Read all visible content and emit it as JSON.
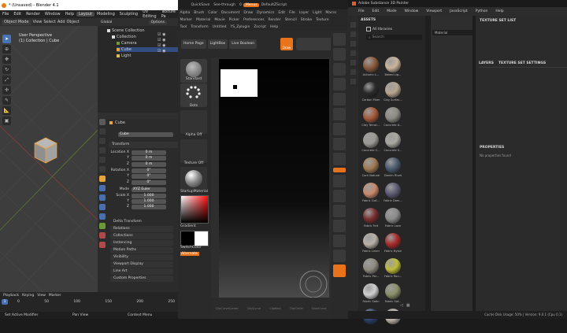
{
  "blender": {
    "title": "* (Unsaved) - Blender 4.1",
    "workspaces": [
      "File",
      "Edit",
      "Render",
      "Window",
      "Help",
      "Layout",
      "Modeling",
      "Sculpting",
      "UV Editing",
      "Texture Pa"
    ],
    "mode": "Object Mode",
    "view_menu": [
      "View",
      "Select",
      "Add",
      "Object"
    ],
    "global": "Global",
    "options": "Options",
    "viewport_title": "User Perspective",
    "viewport_subtitle": "(1) Collection | Cube",
    "outliner": {
      "root": "Scene Collection",
      "items": [
        "Collection",
        "Camera",
        "Cube",
        "Light"
      ]
    },
    "properties": {
      "object_name": "Cube",
      "name_field": "Cube",
      "transform": "Transform",
      "location_label": "Location X",
      "location": [
        "0 m",
        "0 m",
        "0 m"
      ],
      "axes": [
        "Y",
        "Z"
      ],
      "rotation_label": "Rotation X",
      "rotation": [
        "0°",
        "0°",
        "0°"
      ],
      "mode_label": "Mode",
      "mode_value": "XYZ Euler",
      "scale_label": "Scale X",
      "scale": [
        "1.000",
        "1.000",
        "1.000"
      ],
      "sections": [
        "Delta Transform",
        "Relations",
        "Collections",
        "Instancing",
        "Motion Paths",
        "Visibility",
        "Viewport Display",
        "Line Art",
        "Custom Properties"
      ]
    },
    "timeline": {
      "menu": [
        "Playback",
        "Keying",
        "View",
        "Marker"
      ],
      "frame": "1",
      "ticks": [
        "0",
        "50",
        "100",
        "150",
        "200",
        "250"
      ],
      "status": [
        "Set Active Modifier",
        "Pan View",
        "Context Menu"
      ]
    }
  },
  "zbrush": {
    "top_menu": [
      "QuickSave",
      "See-through",
      "0",
      "Menus",
      "DefaultZScript"
    ],
    "menu_row1": [
      "Alpha",
      "Brush",
      "Color",
      "Document",
      "Draw",
      "Dynamics",
      "Edit",
      "File",
      "Layer",
      "Light",
      "Macro"
    ],
    "menu_row2": [
      "Marker",
      "Material",
      "Movie",
      "Picker",
      "Preferences",
      "Render",
      "Stencil",
      "Stroke",
      "Texture"
    ],
    "menu_row3": [
      "Tool",
      "Transform",
      "Untitled",
      "YS_Zplugin",
      "Zscript",
      "Help"
    ],
    "shelf": [
      "Home Page",
      "LightBox",
      "Live Boolean"
    ],
    "draw_btn": "Draw",
    "left_labels": [
      "Standard",
      "Dots",
      "Alpha Off",
      "Texture Off",
      "StartupMaterial",
      "Gradient",
      "SwitchColor",
      "Alternate"
    ],
    "bottom_icons": [
      "ClipCurveCenter",
      "ClipCurve",
      "ClipRect",
      "ClipCircle",
      "SliceCurve"
    ]
  },
  "substance": {
    "title": "Adobe Substance 3D Painter",
    "menu": [
      "File",
      "Edit",
      "Mode",
      "Window",
      "Viewport",
      "JavaScript",
      "Python",
      "Help"
    ],
    "assets_header": "ASSETS",
    "all_libraries": "All libraries",
    "search_placeholder": "Search",
    "viewport_dd": "Material",
    "texture_set_list": "TEXTURE SET LIST",
    "layers": "LAYERS",
    "texture_set_settings": "TEXTURE SET SETTINGS",
    "properties": "PROPERTIES",
    "no_props": "No properties found",
    "status": "Cache Disk Usage:  50% | Version: 9.0.1 (Cpu 0.1)",
    "materials": [
      {
        "name": "Autumn L...",
        "color": "#8a5a3c"
      },
      {
        "name": "Baked Lig...",
        "color": "#c9b39a"
      },
      {
        "name": "Carbon Fiber",
        "color": "#2a2a2a"
      },
      {
        "name": "Clay Surfac...",
        "color": "#b6a58f"
      },
      {
        "name": "Clay Terrac...",
        "color": "#a45a3a"
      },
      {
        "name": "Concrete A...",
        "color": "#8d8a84"
      },
      {
        "name": "Concrete C...",
        "color": "#9c9a94"
      },
      {
        "name": "Concrete S...",
        "color": "#a9a7a0"
      },
      {
        "name": "Cork Natural",
        "color": "#9e7a52"
      },
      {
        "name": "Denim Rivet",
        "color": "#4a5a6e"
      },
      {
        "name": "Fabric Coll...",
        "color": "#c9896a"
      },
      {
        "name": "Fabric Dam...",
        "color": "#5c5a72"
      },
      {
        "name": "Fabric Felt",
        "color": "#7a2e2e"
      },
      {
        "name": "Fabric Lace",
        "color": "#8a8a8a"
      },
      {
        "name": "Fabric Linen",
        "color": "#b8b2a6"
      },
      {
        "name": "Fabric Nylon",
        "color": "#a82a2a"
      },
      {
        "name": "Fabric Pol...",
        "color": "#8e8a80"
      },
      {
        "name": "Fabric Rou...",
        "color": "#bcbc3a"
      },
      {
        "name": "Fabric Satin",
        "color": "#cfcfcf"
      },
      {
        "name": "Fabric Sof...",
        "color": "#8a8e6a"
      },
      {
        "name": "",
        "color": "#2c3e6a"
      },
      {
        "name": "",
        "color": "#b8b2a8"
      }
    ]
  }
}
